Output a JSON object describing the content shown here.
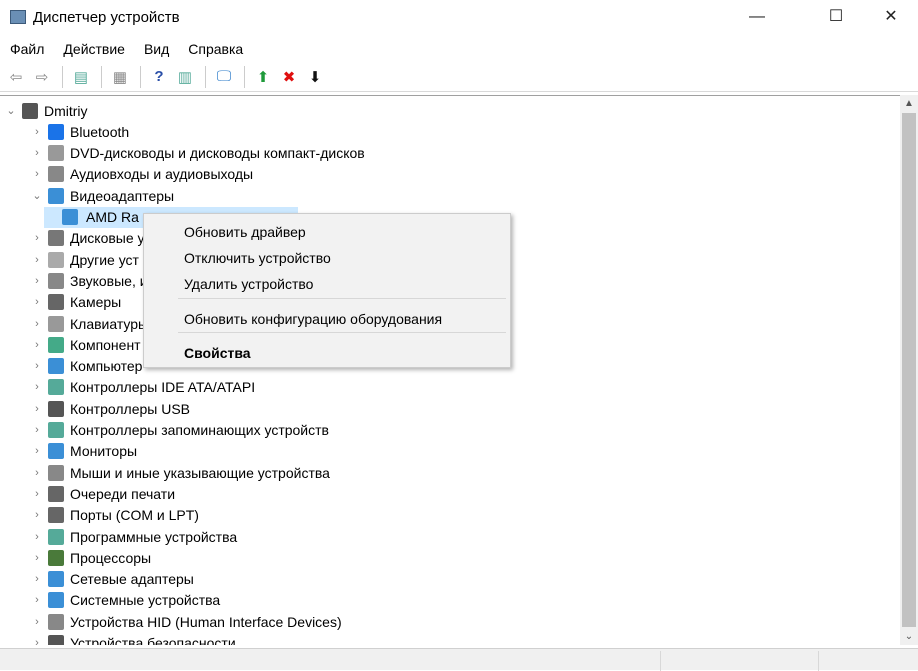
{
  "window": {
    "title": "Диспетчер устройств",
    "minimize": "—",
    "maximize": "☐",
    "close": "✕"
  },
  "menu": [
    "Файл",
    "Действие",
    "Вид",
    "Справка"
  ],
  "toolbar": [
    {
      "icon": "back-arrow-icon",
      "glyph": "⇦",
      "color": "#888"
    },
    {
      "icon": "forward-arrow-icon",
      "glyph": "⇨",
      "color": "#888"
    },
    {
      "icon": "show-hide-console-tree-icon",
      "glyph": "▤",
      "color": "#5a9"
    },
    {
      "icon": "properties-icon",
      "glyph": "▦",
      "color": "#888"
    },
    {
      "icon": "help-icon",
      "glyph": "?",
      "color": "#2a4fa8"
    },
    {
      "icon": "action-pane-icon",
      "glyph": "▥",
      "color": "#5a9"
    },
    {
      "icon": "scan-hardware-icon",
      "glyph": "🖵",
      "color": "#2b7bc9"
    },
    {
      "icon": "update-driver-icon",
      "glyph": "⬆",
      "color": "#1f9a3a"
    },
    {
      "icon": "uninstall-icon",
      "glyph": "✖",
      "color": "#e01010"
    },
    {
      "icon": "download-icon",
      "glyph": "⬇",
      "color": "#111"
    }
  ],
  "tree": {
    "root": "Dmitriy",
    "items": [
      {
        "label": "Bluetooth",
        "icon": "bluetooth-icon",
        "color": "#1a73e8",
        "expanded": false
      },
      {
        "label": "DVD-дисководы и дисководы компакт-дисков",
        "icon": "dvd-drive-icon",
        "color": "#999",
        "expanded": false
      },
      {
        "label": "Аудиовходы и аудиовыходы",
        "icon": "speaker-icon",
        "color": "#888",
        "expanded": false
      },
      {
        "label": "Видеоадаптеры",
        "icon": "display-adapter-icon",
        "color": "#3b8fd6",
        "expanded": true
      },
      {
        "label": "AMD Ra",
        "icon": "display-adapter-icon",
        "color": "#3b8fd6",
        "child": true,
        "selected": true
      },
      {
        "label": "Дисковые у",
        "icon": "disk-drive-icon",
        "color": "#777"
      },
      {
        "label": "Другие уст",
        "icon": "unknown-device-icon",
        "color": "#aaa"
      },
      {
        "label": "Звуковые, и",
        "icon": "sound-icon",
        "color": "#888"
      },
      {
        "label": "Камеры",
        "icon": "camera-icon",
        "color": "#666"
      },
      {
        "label": "Клавиатуры",
        "icon": "keyboard-icon",
        "color": "#999"
      },
      {
        "label": "Компонент",
        "icon": "software-component-icon",
        "color": "#4a8"
      },
      {
        "label": "Компьютер",
        "icon": "computer-icon",
        "color": "#3b8fd6"
      },
      {
        "label": "Контроллеры IDE ATA/ATAPI",
        "icon": "ide-controller-icon",
        "color": "#5a9"
      },
      {
        "label": "Контроллеры USB",
        "icon": "usb-icon",
        "color": "#555"
      },
      {
        "label": "Контроллеры запоминающих устройств",
        "icon": "storage-controller-icon",
        "color": "#5a9"
      },
      {
        "label": "Мониторы",
        "icon": "monitor-icon",
        "color": "#3b8fd6"
      },
      {
        "label": "Мыши и иные указывающие устройства",
        "icon": "mouse-icon",
        "color": "#888"
      },
      {
        "label": "Очереди печати",
        "icon": "printer-icon",
        "color": "#666"
      },
      {
        "label": "Порты (COM и LPT)",
        "icon": "port-icon",
        "color": "#666"
      },
      {
        "label": "Программные устройства",
        "icon": "software-device-icon",
        "color": "#5a9"
      },
      {
        "label": "Процессоры",
        "icon": "processor-icon",
        "color": "#4a7a3a"
      },
      {
        "label": "Сетевые адаптеры",
        "icon": "network-adapter-icon",
        "color": "#3b8fd6"
      },
      {
        "label": "Системные устройства",
        "icon": "system-device-icon",
        "color": "#3b8fd6"
      },
      {
        "label": "Устройства HID (Human Interface Devices)",
        "icon": "hid-icon",
        "color": "#888"
      },
      {
        "label": "Устройства безопасности",
        "icon": "security-device-icon",
        "color": "#555"
      }
    ]
  },
  "context_menu": {
    "update_driver": "Обновить драйвер",
    "disable_device": "Отключить устройство",
    "uninstall_device": "Удалить устройство",
    "scan_hardware": "Обновить конфигурацию оборудования",
    "properties": "Свойства"
  }
}
